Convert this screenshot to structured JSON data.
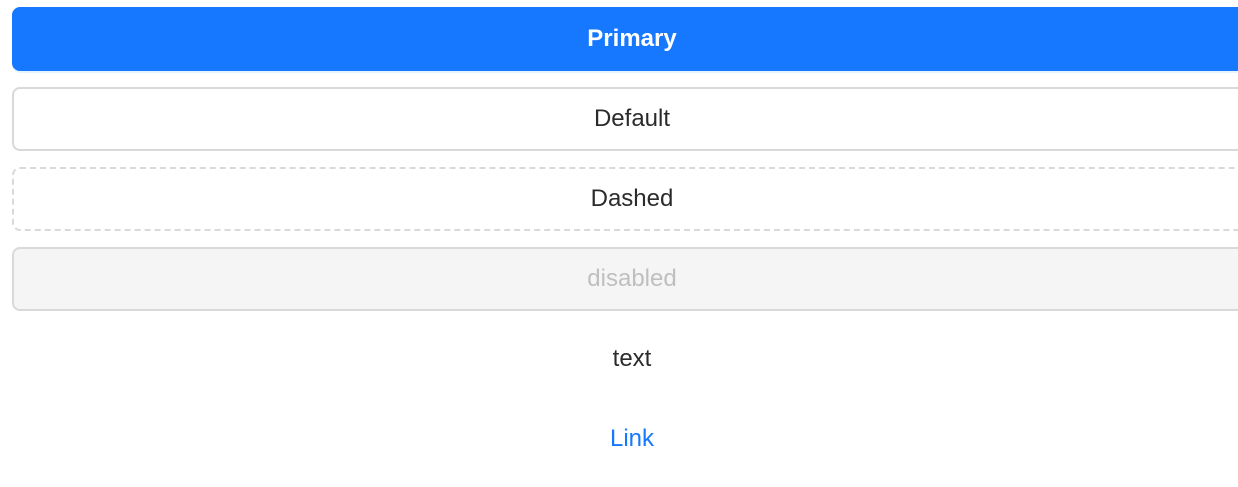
{
  "buttons": {
    "primary": {
      "label": "Primary"
    },
    "default": {
      "label": "Default"
    },
    "dashed": {
      "label": "Dashed"
    },
    "disabled": {
      "label": "disabled"
    },
    "text": {
      "label": "text"
    },
    "link": {
      "label": "Link"
    }
  },
  "colors": {
    "primary": "#1677ff",
    "border": "#d9d9d9",
    "disabled_bg": "#f5f5f5",
    "disabled_text": "#bfbfbf",
    "text": "#2b2b2b",
    "link": "#1677ff"
  }
}
